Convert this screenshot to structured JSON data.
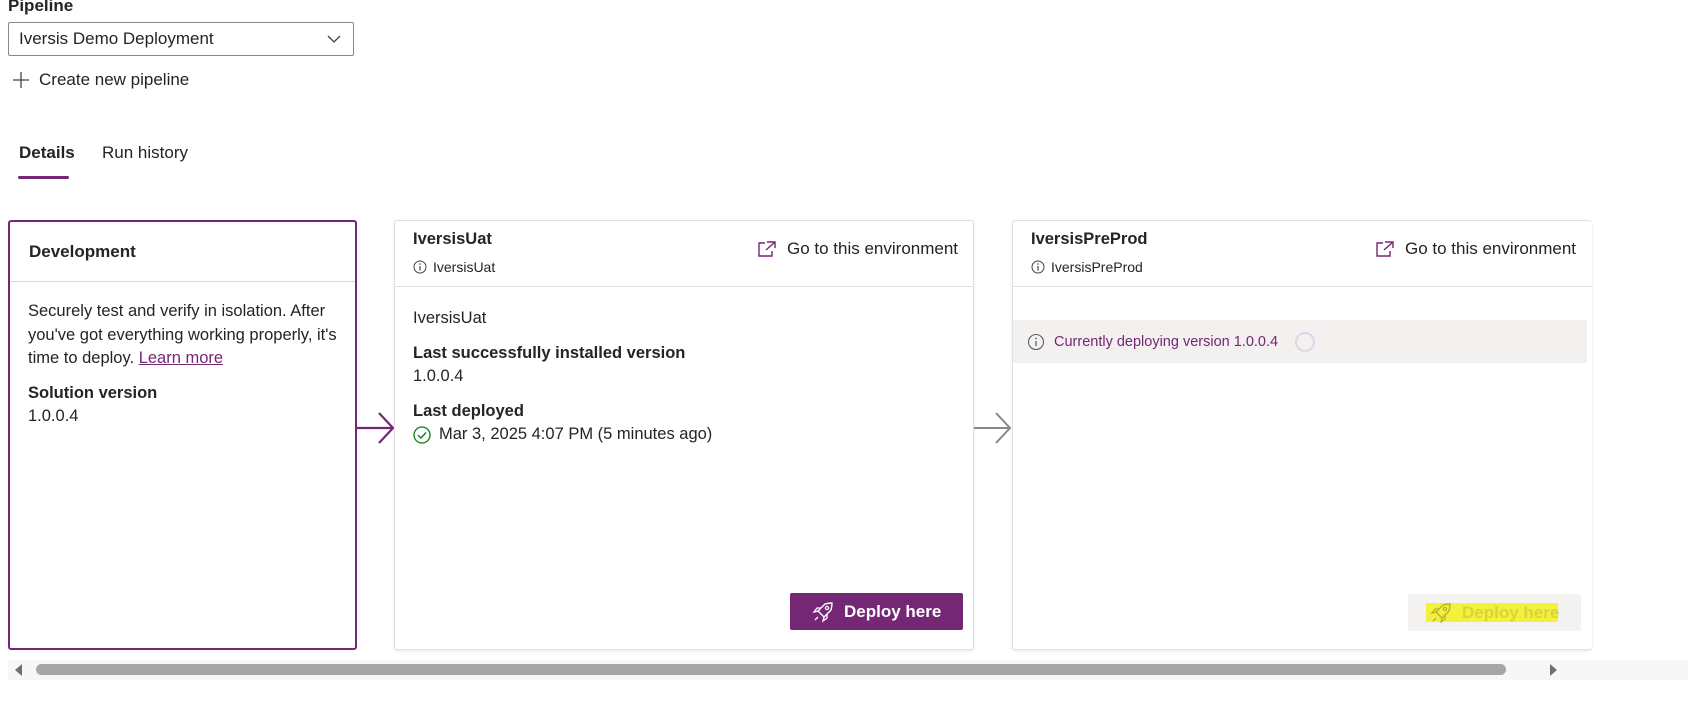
{
  "pipeline": {
    "label": "Pipeline",
    "selected": "Iversis Demo Deployment",
    "create_label": "Create new pipeline"
  },
  "tabs": [
    {
      "label": "Details",
      "active": true
    },
    {
      "label": "Run history",
      "active": false
    }
  ],
  "development": {
    "title": "Development",
    "description": "Securely test and verify in isolation. After you've got everything working properly, it's time to deploy.",
    "learn_more": "Learn more",
    "solution_version_label": "Solution version",
    "solution_version": "1.0.0.4"
  },
  "stages": [
    {
      "name": "IversisUat",
      "environment": "IversisUat",
      "goto_label": "Go to this environment",
      "body_name": "IversisUat",
      "installed_label": "Last successfully installed version",
      "installed_version": "1.0.0.4",
      "deployed_label": "Last deployed",
      "deployed_value": "Mar 3, 2025 4:07 PM (5 minutes ago)",
      "deploy_label": "Deploy here"
    },
    {
      "name": "IversisPreProd",
      "environment": "IversisPreProd",
      "goto_label": "Go to this environment",
      "status": "Currently deploying version 1.0.0.4",
      "deploy_label": "Deploy here"
    }
  ],
  "colors": {
    "accent": "#742774",
    "success": "#107c10",
    "disabled_bg": "#f3f2f1",
    "highlight": "#e6e13a"
  }
}
